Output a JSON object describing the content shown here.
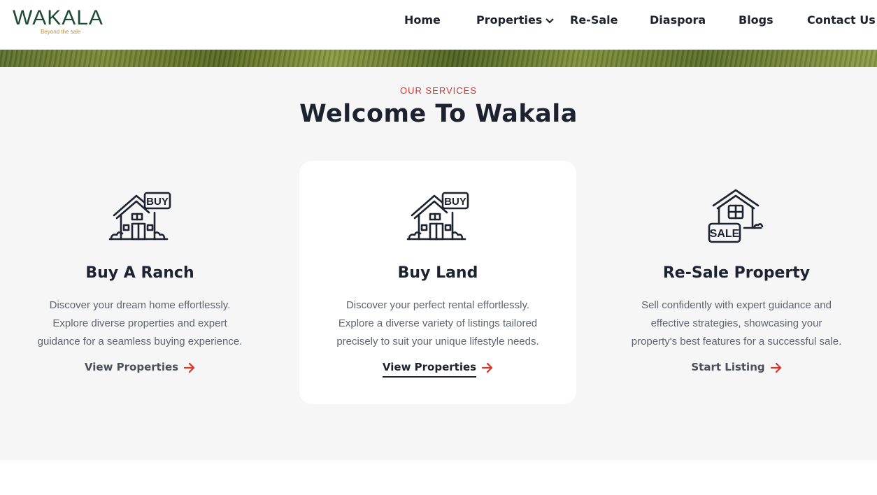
{
  "header": {
    "logo": {
      "wordmark": "WAKALA",
      "tagline": "Beyond the sale"
    },
    "nav": [
      {
        "label": "Home"
      },
      {
        "label": "Properties",
        "has_dropdown": true
      },
      {
        "label": "Re-Sale"
      },
      {
        "label": "Diaspora"
      },
      {
        "label": "Blogs"
      },
      {
        "label": "Contact Us"
      }
    ]
  },
  "services": {
    "eyebrow": "OUR SERVICES",
    "title": "Welcome To Wakala",
    "cards": [
      {
        "icon": "house-buy-icon",
        "title": "Buy A Ranch",
        "description": [
          "Discover your dream home effortlessly.",
          "Explore diverse properties and expert",
          "guidance for a seamless buying experience."
        ],
        "link": "View Properties",
        "active": false
      },
      {
        "icon": "house-buy-icon",
        "title": "Buy Land",
        "description": [
          "Discover your perfect rental effortlessly.",
          "Explore a diverse variety of listings tailored",
          "precisely to suit your unique lifestyle needs."
        ],
        "link": "View Properties",
        "active": true
      },
      {
        "icon": "house-sale-icon",
        "title": "Re-Sale Property",
        "description": [
          "Sell confidently with expert guidance and",
          "effective strategies, showcasing your",
          "property's best features for a successful sale."
        ],
        "link": "Start Listing",
        "active": false
      }
    ]
  },
  "colors": {
    "accent": "#e0312a",
    "text_dark": "#1c2230",
    "logo_green": "#1e4a33",
    "logo_gold": "#c08a3a",
    "section_bg": "#f6f6f6"
  }
}
